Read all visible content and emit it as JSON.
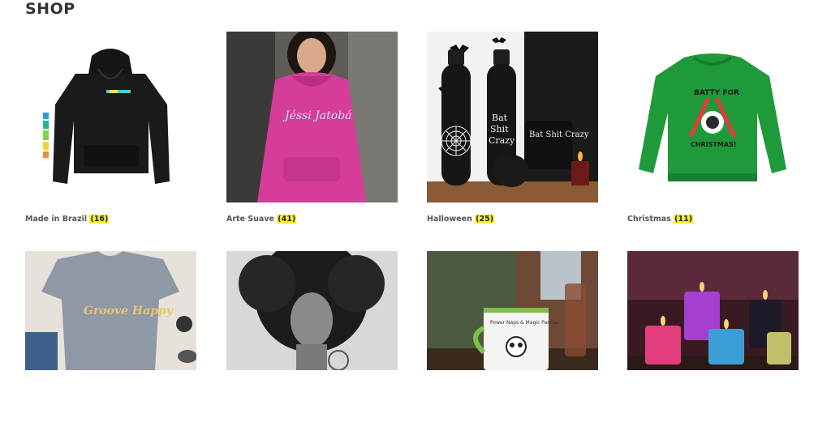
{
  "page": {
    "heading": "SHOP"
  },
  "categories": [
    {
      "name": "Made in Brazil",
      "count": "(16)"
    },
    {
      "name": "Arte Suave",
      "count": "(41)"
    },
    {
      "name": "Halloween",
      "count": "(25)"
    },
    {
      "name": "Christmas",
      "count": "(11)"
    },
    {
      "name": "",
      "count": ""
    },
    {
      "name": "",
      "count": ""
    },
    {
      "name": "",
      "count": ""
    },
    {
      "name": "",
      "count": ""
    }
  ],
  "image_text": {
    "arte_suave_script": "Jéssi Jatobá",
    "bottle_text": "Bat Shit Crazy",
    "mug_text": "Bat Shit Crazy",
    "christmas_text_top": "BATTY FOR",
    "christmas_text_bottom": "CHRISTMAS!",
    "tee_text": "Groove Happy",
    "panda_mug_text": "Power Naps & Magic Pandas"
  },
  "colors": {
    "count_highlight": "#f7f02d",
    "heading": "#333333"
  }
}
